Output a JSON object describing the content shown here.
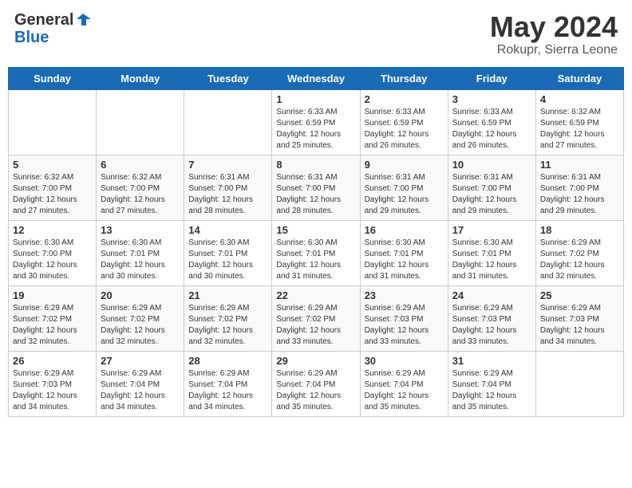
{
  "header": {
    "logo_general": "General",
    "logo_blue": "Blue",
    "month_year": "May 2024",
    "location": "Rokupr, Sierra Leone"
  },
  "weekdays": [
    "Sunday",
    "Monday",
    "Tuesday",
    "Wednesday",
    "Thursday",
    "Friday",
    "Saturday"
  ],
  "weeks": [
    [
      {
        "day": "",
        "info": ""
      },
      {
        "day": "",
        "info": ""
      },
      {
        "day": "",
        "info": ""
      },
      {
        "day": "1",
        "info": "Sunrise: 6:33 AM\nSunset: 6:59 PM\nDaylight: 12 hours\nand 25 minutes."
      },
      {
        "day": "2",
        "info": "Sunrise: 6:33 AM\nSunset: 6:59 PM\nDaylight: 12 hours\nand 26 minutes."
      },
      {
        "day": "3",
        "info": "Sunrise: 6:33 AM\nSunset: 6:59 PM\nDaylight: 12 hours\nand 26 minutes."
      },
      {
        "day": "4",
        "info": "Sunrise: 6:32 AM\nSunset: 6:59 PM\nDaylight: 12 hours\nand 27 minutes."
      }
    ],
    [
      {
        "day": "5",
        "info": "Sunrise: 6:32 AM\nSunset: 7:00 PM\nDaylight: 12 hours\nand 27 minutes."
      },
      {
        "day": "6",
        "info": "Sunrise: 6:32 AM\nSunset: 7:00 PM\nDaylight: 12 hours\nand 27 minutes."
      },
      {
        "day": "7",
        "info": "Sunrise: 6:31 AM\nSunset: 7:00 PM\nDaylight: 12 hours\nand 28 minutes."
      },
      {
        "day": "8",
        "info": "Sunrise: 6:31 AM\nSunset: 7:00 PM\nDaylight: 12 hours\nand 28 minutes."
      },
      {
        "day": "9",
        "info": "Sunrise: 6:31 AM\nSunset: 7:00 PM\nDaylight: 12 hours\nand 29 minutes."
      },
      {
        "day": "10",
        "info": "Sunrise: 6:31 AM\nSunset: 7:00 PM\nDaylight: 12 hours\nand 29 minutes."
      },
      {
        "day": "11",
        "info": "Sunrise: 6:31 AM\nSunset: 7:00 PM\nDaylight: 12 hours\nand 29 minutes."
      }
    ],
    [
      {
        "day": "12",
        "info": "Sunrise: 6:30 AM\nSunset: 7:00 PM\nDaylight: 12 hours\nand 30 minutes."
      },
      {
        "day": "13",
        "info": "Sunrise: 6:30 AM\nSunset: 7:01 PM\nDaylight: 12 hours\nand 30 minutes."
      },
      {
        "day": "14",
        "info": "Sunrise: 6:30 AM\nSunset: 7:01 PM\nDaylight: 12 hours\nand 30 minutes."
      },
      {
        "day": "15",
        "info": "Sunrise: 6:30 AM\nSunset: 7:01 PM\nDaylight: 12 hours\nand 31 minutes."
      },
      {
        "day": "16",
        "info": "Sunrise: 6:30 AM\nSunset: 7:01 PM\nDaylight: 12 hours\nand 31 minutes."
      },
      {
        "day": "17",
        "info": "Sunrise: 6:30 AM\nSunset: 7:01 PM\nDaylight: 12 hours\nand 31 minutes."
      },
      {
        "day": "18",
        "info": "Sunrise: 6:29 AM\nSunset: 7:02 PM\nDaylight: 12 hours\nand 32 minutes."
      }
    ],
    [
      {
        "day": "19",
        "info": "Sunrise: 6:29 AM\nSunset: 7:02 PM\nDaylight: 12 hours\nand 32 minutes."
      },
      {
        "day": "20",
        "info": "Sunrise: 6:29 AM\nSunset: 7:02 PM\nDaylight: 12 hours\nand 32 minutes."
      },
      {
        "day": "21",
        "info": "Sunrise: 6:29 AM\nSunset: 7:02 PM\nDaylight: 12 hours\nand 32 minutes."
      },
      {
        "day": "22",
        "info": "Sunrise: 6:29 AM\nSunset: 7:02 PM\nDaylight: 12 hours\nand 33 minutes."
      },
      {
        "day": "23",
        "info": "Sunrise: 6:29 AM\nSunset: 7:03 PM\nDaylight: 12 hours\nand 33 minutes."
      },
      {
        "day": "24",
        "info": "Sunrise: 6:29 AM\nSunset: 7:03 PM\nDaylight: 12 hours\nand 33 minutes."
      },
      {
        "day": "25",
        "info": "Sunrise: 6:29 AM\nSunset: 7:03 PM\nDaylight: 12 hours\nand 34 minutes."
      }
    ],
    [
      {
        "day": "26",
        "info": "Sunrise: 6:29 AM\nSunset: 7:03 PM\nDaylight: 12 hours\nand 34 minutes."
      },
      {
        "day": "27",
        "info": "Sunrise: 6:29 AM\nSunset: 7:04 PM\nDaylight: 12 hours\nand 34 minutes."
      },
      {
        "day": "28",
        "info": "Sunrise: 6:29 AM\nSunset: 7:04 PM\nDaylight: 12 hours\nand 34 minutes."
      },
      {
        "day": "29",
        "info": "Sunrise: 6:29 AM\nSunset: 7:04 PM\nDaylight: 12 hours\nand 35 minutes."
      },
      {
        "day": "30",
        "info": "Sunrise: 6:29 AM\nSunset: 7:04 PM\nDaylight: 12 hours\nand 35 minutes."
      },
      {
        "day": "31",
        "info": "Sunrise: 6:29 AM\nSunset: 7:04 PM\nDaylight: 12 hours\nand 35 minutes."
      },
      {
        "day": "",
        "info": ""
      }
    ]
  ]
}
